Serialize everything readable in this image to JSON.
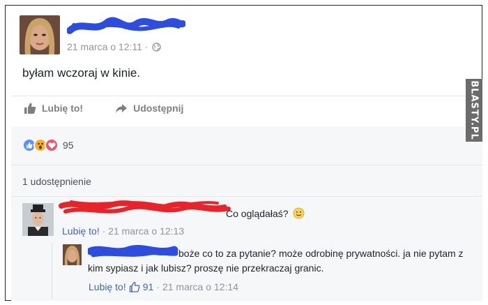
{
  "post": {
    "timestamp": "21 marca o 12:11 · ",
    "text": "byłam wczoraj w kinie.",
    "like_label": "Lubię to!",
    "share_label": "Udostępnij"
  },
  "stats": {
    "reaction_count": "95",
    "shares_label": "1 udostępnienie"
  },
  "comments": [
    {
      "text": "Co oglądałaś?",
      "like_label": "Lubię to!",
      "sep": " · ",
      "timestamp": "21 marca o 12:13"
    }
  ],
  "reply": {
    "text": "boże co to za pytanie? może odrobinę prywatności. ja nie pytam z kim sypiasz i jak lubisz? proszę nie przekraczaj granic.",
    "like_label": "Lubię to!",
    "like_count": "91",
    "sep": " · ",
    "timestamp": "21 marca o 12:14"
  },
  "watermark": "BLASTY.PL",
  "colors": {
    "link": "#4267b2",
    "like_reaction": "#5890ff",
    "wow_reaction": "#f7b125",
    "love_reaction": "#f25268",
    "redaction_blue": "#2d4de0",
    "redaction_red": "#e8232a"
  },
  "icons": {
    "globe": "globe-icon",
    "like": "thumbs-up-icon",
    "share": "share-arrow-icon",
    "smile": "smile-emoji-icon"
  }
}
